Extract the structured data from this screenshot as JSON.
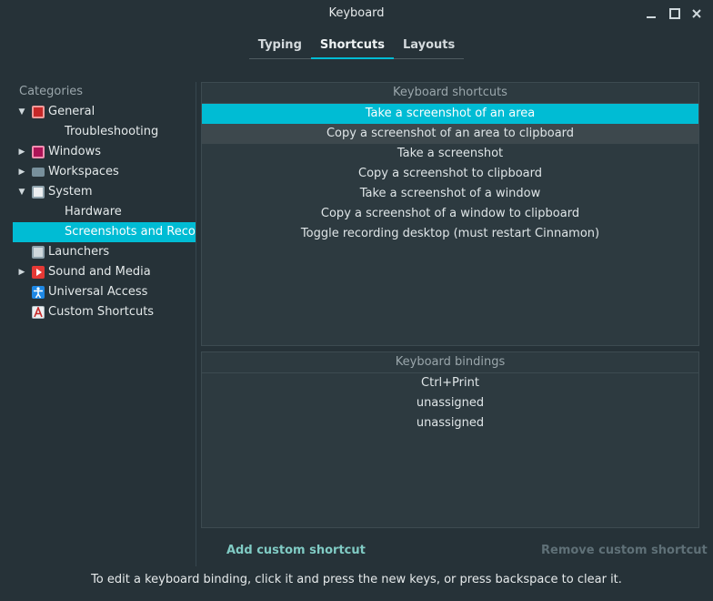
{
  "window": {
    "title": "Keyboard"
  },
  "tabs": [
    {
      "label": "Typing"
    },
    {
      "label": "Shortcuts"
    },
    {
      "label": "Layouts"
    }
  ],
  "sidebar": {
    "header": "Categories",
    "items": [
      {
        "label": "General",
        "icon": "preferences-icon",
        "level": 0,
        "expanded": true
      },
      {
        "label": "Troubleshooting",
        "level": 1
      },
      {
        "label": "Windows",
        "icon": "windows-icon",
        "level": 0,
        "expanded": false
      },
      {
        "label": "Workspaces",
        "icon": "monitor-icon",
        "level": 0,
        "expanded": false
      },
      {
        "label": "System",
        "icon": "system-icon",
        "level": 0,
        "expanded": true
      },
      {
        "label": "Hardware",
        "level": 1
      },
      {
        "label": "Screenshots and Recording",
        "level": 1,
        "selected": true
      },
      {
        "label": "Launchers",
        "icon": "launcher-icon",
        "level": 0
      },
      {
        "label": "Sound and Media",
        "icon": "media-play-icon",
        "level": 0,
        "expanded": false
      },
      {
        "label": "Universal Access",
        "icon": "accessibility-icon",
        "level": 0
      },
      {
        "label": "Custom Shortcuts",
        "icon": "custom-shortcut-icon",
        "level": 0
      }
    ]
  },
  "shortcuts": {
    "header": "Keyboard shortcuts",
    "items": [
      "Take a screenshot of an area",
      "Copy a screenshot of an area to clipboard",
      "Take a screenshot",
      "Copy a screenshot to clipboard",
      "Take a screenshot of a window",
      "Copy a screenshot of a window to clipboard",
      "Toggle recording desktop (must restart Cinnamon)"
    ]
  },
  "bindings": {
    "header": "Keyboard bindings",
    "items": [
      "Ctrl+Print",
      "unassigned",
      "unassigned"
    ]
  },
  "actions": {
    "add": "Add custom shortcut",
    "remove": "Remove custom shortcut"
  },
  "hint": "To edit a keyboard binding, click it and press the new keys, or press backspace to clear it.",
  "colors": {
    "background": "#263238",
    "panel": "#2d3a40",
    "accent": "#00bcd4",
    "add_action": "#80cbc4",
    "remove_action_disabled": "#5f7077"
  }
}
